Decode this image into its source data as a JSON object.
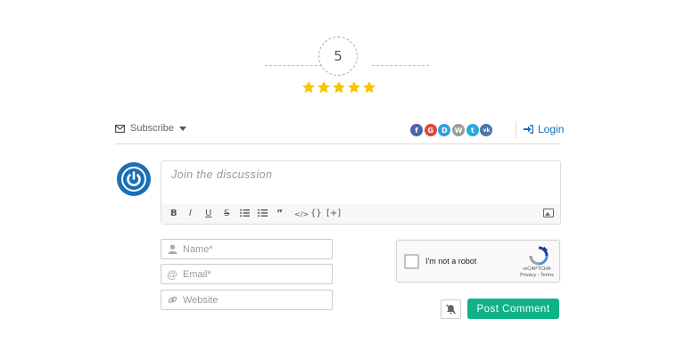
{
  "rating": {
    "score": "5",
    "stars_filled": 5,
    "stars_total": 5,
    "star_color": "#f5c500"
  },
  "toolbar": {
    "subscribe_label": "Subscribe",
    "login_label": "Login",
    "social_logins": [
      {
        "name": "facebook",
        "glyph": "f",
        "color": "#4a66a8"
      },
      {
        "name": "google",
        "glyph": "G",
        "color": "#dc4a38"
      },
      {
        "name": "disqus",
        "glyph": "D",
        "color": "#2f9fe3"
      },
      {
        "name": "wordpress",
        "glyph": "W",
        "color": "#9a9a9a"
      },
      {
        "name": "twitter",
        "glyph": "t",
        "color": "#2aa9e0"
      },
      {
        "name": "vk",
        "glyph": "vk",
        "color": "#4a76a8"
      }
    ]
  },
  "editor": {
    "placeholder": "Join the discussion",
    "tools": [
      "B",
      "I",
      "U",
      "S",
      "ol",
      "ul",
      "99",
      "</>",
      "{}",
      "[+]",
      "image"
    ]
  },
  "form": {
    "name_placeholder": "Name*",
    "email_placeholder": "Email*",
    "website_placeholder": "Website",
    "captcha_label": "I'm not a robot",
    "captcha_brand": "reCAPTCHA",
    "captcha_links": "Privacy - Terms",
    "submit_label": "Post Comment"
  },
  "colors": {
    "accent": "#0fb287",
    "link": "#1a6fb5"
  }
}
